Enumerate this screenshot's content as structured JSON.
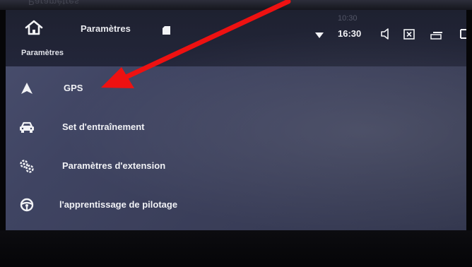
{
  "header": {
    "title": "Paramètres",
    "clock": "16:30",
    "home_icon": "home-icon",
    "sd_icon": "sd-card-icon",
    "wifi_icon": "wifi-icon",
    "volume_icon": "volume-icon",
    "close_icon": "close-app-icon",
    "windows_icon": "recent-apps-icon",
    "back_icon": "back-icon"
  },
  "reflection": {
    "text": "Paramètres",
    "clock": "10:30"
  },
  "section": {
    "title": "Paramètres"
  },
  "menu": {
    "items": [
      {
        "label": "GPS",
        "icon": "navigation-arrow-icon"
      },
      {
        "label": "Set d'entraînement",
        "icon": "car-icon"
      },
      {
        "label": "Paramètres d'extension",
        "icon": "gears-icon"
      },
      {
        "label": "l'apprentissage de pilotage",
        "icon": "steering-wheel-icon"
      }
    ]
  },
  "annotation": {
    "color": "#ee1111",
    "target": "GPS"
  },
  "colors": {
    "panel": "#3f4462",
    "topbar": "#1e2130",
    "text": "#f0f1f5"
  }
}
